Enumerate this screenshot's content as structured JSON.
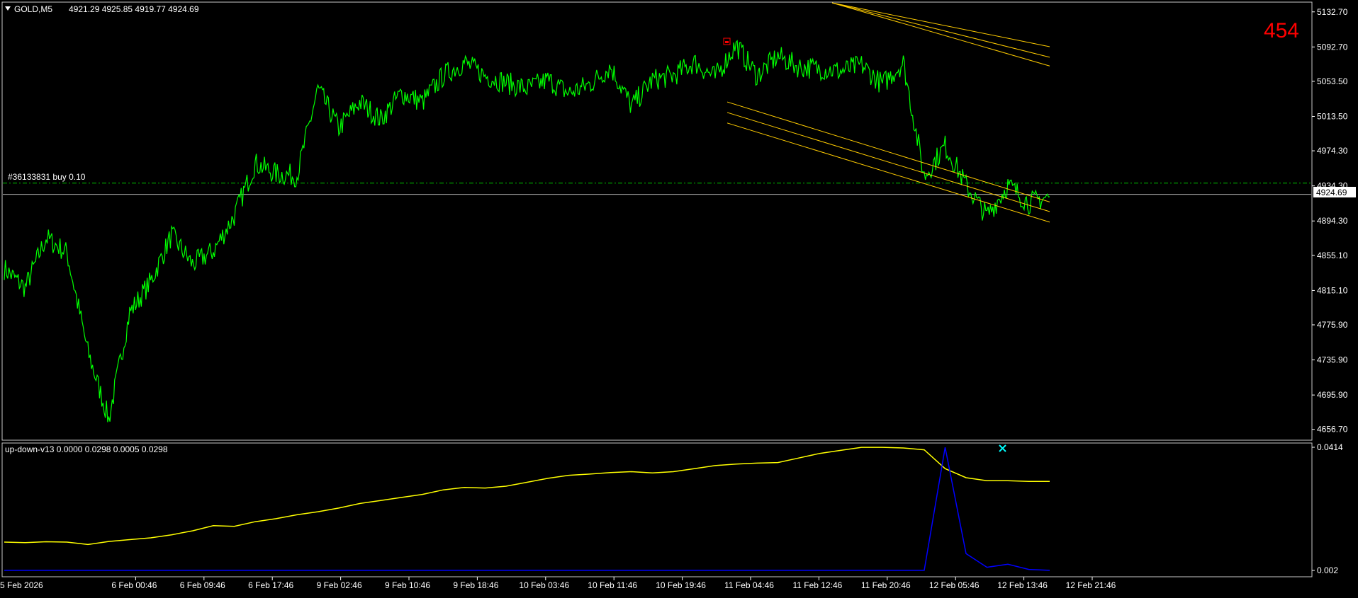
{
  "header": {
    "dropdown_icon": "triangle-down-icon",
    "symbol": "GOLD,M5",
    "ohlc": "4921.29 4925.85 4919.77 4924.69"
  },
  "counter_label": "454",
  "order_label": "#36133831 buy 0.10",
  "current_price_label": "4924.69",
  "indicator_title": "up-down-v13 0.0000 0.0298 0.0005 0.0298",
  "chart_icon": "flag-icon",
  "signal_icon": "cross-marker-icon",
  "colors": {
    "background": "#000000",
    "price": "#00ff00",
    "channel": "#ffcc00",
    "order_line": "#00c000",
    "axis": "#ffffff",
    "counter": "#ff0000",
    "indicator_main": "#ffff00",
    "indicator_histogram": "#0000ff",
    "signal": "#00ffff"
  },
  "chart_data": [
    {
      "type": "line",
      "title": "GOLD,M5",
      "x": [
        "5 Feb 2026",
        "6 Feb 00:46",
        "6 Feb 09:46",
        "6 Feb 17:46",
        "9 Feb 02:46",
        "9 Feb 10:46",
        "9 Feb 18:46",
        "10 Feb 03:46",
        "10 Feb 11:46",
        "10 Feb 19:46",
        "11 Feb 04:46",
        "11 Feb 12:46",
        "11 Feb 20:46",
        "12 Feb 05:46",
        "12 Feb 13:46",
        "12 Feb 21:46"
      ],
      "y_ticks": [
        5132.7,
        5092.7,
        5053.5,
        5013.5,
        4974.3,
        4934.3,
        4894.3,
        4855.1,
        4815.1,
        4775.9,
        4735.9,
        4695.9,
        4656.7
      ],
      "ylim": [
        4646,
        5143
      ],
      "current_price": 4924.69,
      "order_price": 4937.5,
      "series": [
        {
          "values": [
            4840,
            4818,
            4875,
            4858,
            4745,
            4668,
            4790,
            4825,
            4878,
            4845,
            4860,
            4900,
            4960,
            4948,
            4946,
            5045,
            5000,
            5030,
            5010,
            5040,
            5030,
            5060,
            5075,
            5060,
            5052,
            5045,
            5055,
            5040,
            5050,
            5070,
            5025,
            5055,
            5060,
            5075,
            5058,
            5095,
            5060,
            5082,
            5070,
            5068,
            5065,
            5072,
            5050,
            5075,
            4945,
            4980,
            4935,
            4900,
            4935,
            4915,
            4922
          ]
        }
      ],
      "channels": [
        {
          "from": [
            "11 Feb 14:00",
            5143
          ],
          "to": [
            "12 Feb 21:46",
            5093
          ]
        },
        {
          "from": [
            "11 Feb 14:00",
            5143
          ],
          "to": [
            "12 Feb 21:46",
            5081
          ]
        },
        {
          "from": [
            "11 Feb 14:00",
            5143
          ],
          "to": [
            "12 Feb 21:46",
            5071
          ]
        },
        {
          "from": [
            "11 Feb 04:46",
            5030
          ],
          "to": [
            "12 Feb 21:46",
            4916
          ]
        },
        {
          "from": [
            "11 Feb 04:46",
            5018
          ],
          "to": [
            "12 Feb 21:46",
            4905
          ]
        },
        {
          "from": [
            "11 Feb 04:46",
            5006
          ],
          "to": [
            "12 Feb 21:46",
            4893
          ]
        }
      ]
    },
    {
      "type": "line",
      "title": "up-down-v13",
      "y_ticks": [
        "0.0414",
        "0.002"
      ],
      "ylim": [
        0.0,
        0.0415
      ],
      "series": [
        {
          "values": [
            0.0098,
            0.0096,
            0.0099,
            0.0098,
            0.009,
            0.01,
            0.0106,
            0.0112,
            0.0122,
            0.0135,
            0.0152,
            0.015,
            0.0165,
            0.0175,
            0.0188,
            0.0198,
            0.021,
            0.0225,
            0.0235,
            0.0245,
            0.0255,
            0.027,
            0.0278,
            0.0276,
            0.0282,
            0.0295,
            0.0308,
            0.0318,
            0.0322,
            0.0327,
            0.033,
            0.0326,
            0.033,
            0.034,
            0.035,
            0.0355,
            0.0358,
            0.036,
            0.0375,
            0.039,
            0.04,
            0.041,
            0.041,
            0.0408,
            0.0402,
            0.034,
            0.031,
            0.03,
            0.03,
            0.0298,
            0.0298
          ]
        },
        {
          "values": [
            0.0005,
            0.0005,
            0.0005,
            0.0005,
            0.0005,
            0.0005,
            0.0005,
            0.0005,
            0.0005,
            0.0005,
            0.0005,
            0.0005,
            0.0005,
            0.0005,
            0.0005,
            0.0005,
            0.0005,
            0.0005,
            0.0005,
            0.0005,
            0.0005,
            0.0005,
            0.0005,
            0.0005,
            0.0005,
            0.0005,
            0.0005,
            0.0005,
            0.0005,
            0.0005,
            0.0005,
            0.0005,
            0.0005,
            0.0005,
            0.0005,
            0.0005,
            0.0005,
            0.0005,
            0.0005,
            0.0005,
            0.0005,
            0.0005,
            0.0005,
            0.0005,
            0.0005,
            0.041,
            0.006,
            0.0015,
            0.0025,
            0.0008,
            0.0005
          ]
        }
      ]
    }
  ]
}
